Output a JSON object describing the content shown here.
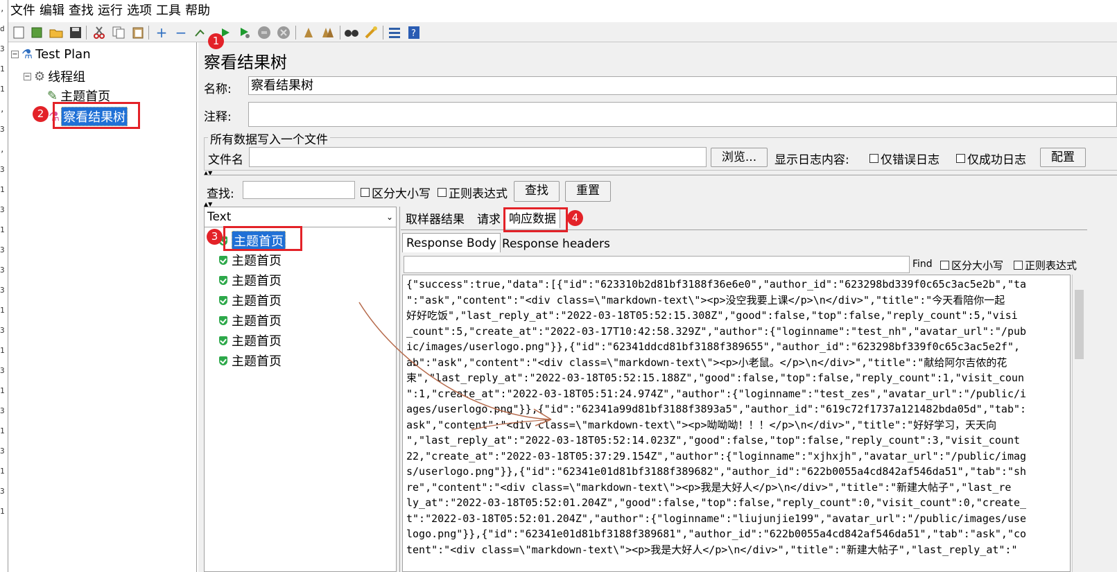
{
  "menu": [
    "文件",
    "编辑",
    "查找",
    "运行",
    "选项",
    "工具",
    "帮助"
  ],
  "tree": {
    "root": "Test Plan",
    "thread_group": "线程组",
    "sampler": "主题首页",
    "listener": "察看结果树"
  },
  "panel": {
    "title": "察看结果树",
    "name_label": "名称:",
    "name_value": "察看结果树",
    "comment_label": "注释:",
    "comment_value": "",
    "file_section": "所有数据写入一个文件",
    "filename_label": "文件名",
    "browse_button": "浏览...",
    "log_label": "显示日志内容:",
    "errors_only": "仅错误日志",
    "success_only": "仅成功日志",
    "config_button": "配置"
  },
  "search": {
    "label": "查找:",
    "case_sensitive": "区分大小写",
    "regex": "正则表达式",
    "find_button": "查找",
    "reset_button": "重置"
  },
  "results": {
    "renderer": "Text",
    "samples": [
      "主题首页",
      "主题首页",
      "主题首页",
      "主题首页",
      "主题首页",
      "主题首页",
      "主题首页"
    ]
  },
  "tabs": {
    "sampler_result": "取样器结果",
    "request": "请求",
    "response_data": "响应数据",
    "response_body": "Response Body",
    "response_headers": "Response headers"
  },
  "response_find": {
    "label": "Find",
    "case_sensitive": "区分大小写",
    "regex": "正则表达式"
  },
  "response_lines": [
    "{\"success\":true,\"data\":[{\"id\":\"623310b2d81bf3188f36e6e0\",\"author_id\":\"623298bd339f0c65c3ac5e2b\",\"ta",
    "\":\"ask\",\"content\":\"<div class=\\\"markdown-text\\\"><p>没空我要上课</p>\\n</div>\",\"title\":\"今天看陪你一起",
    "好好吃饭\",\"last_reply_at\":\"2022-03-18T05:52:15.308Z\",\"good\":false,\"top\":false,\"reply_count\":5,\"visi",
    "_count\":5,\"create_at\":\"2022-03-17T10:42:58.329Z\",\"author\":{\"loginname\":\"test_nh\",\"avatar_url\":\"/pub",
    "ic/images/userlogo.png\"}},{\"id\":\"62341ddcd81bf3188f389655\",\"author_id\":\"623298bf339f0c65c3ac5e2f\",",
    "ab\":\"ask\",\"content\":\"<div class=\\\"markdown-text\\\"><p>小老鼠。</p>\\n</div>\",\"title\":\"献给阿尔吉侬的花",
    "束\",\"last_reply_at\":\"2022-03-18T05:52:15.188Z\",\"good\":false,\"top\":false,\"reply_count\":1,\"visit_coun",
    "\":1,\"create_at\":\"2022-03-18T05:51:24.974Z\",\"author\":{\"loginname\":\"test_zes\",\"avatar_url\":\"/public/i",
    "ages/userlogo.png\"}},{\"id\":\"62341a99d81bf3188f3893a5\",\"author_id\":\"619c72f1737a121482bda05d\",\"tab\":",
    "ask\",\"content\":\"<div class=\\\"markdown-text\\\"><p>呦呦呦！！！</p>\\n</div>\",\"title\":\"好好学习，天天向",
    "\",\"last_reply_at\":\"2022-03-18T05:52:14.023Z\",\"good\":false,\"top\":false,\"reply_count\":3,\"visit_count",
    "22,\"create_at\":\"2022-03-18T05:37:29.154Z\",\"author\":{\"loginname\":\"xjhxjh\",\"avatar_url\":\"/public/imag",
    "s/userlogo.png\"}},{\"id\":\"62341e01d81bf3188f389682\",\"author_id\":\"622b0055a4cd842af546da51\",\"tab\":\"sh",
    "re\",\"content\":\"<div class=\\\"markdown-text\\\"><p>我是大好人</p>\\n</div>\",\"title\":\"新建大帖子\",\"last_re",
    "ly_at\":\"2022-03-18T05:52:01.204Z\",\"good\":false,\"top\":false,\"reply_count\":0,\"visit_count\":0,\"create_",
    "t\":\"2022-03-18T05:52:01.204Z\",\"author\":{\"loginname\":\"liujunjie199\",\"avatar_url\":\"/public/images/use",
    "logo.png\"}},{\"id\":\"62341e01d81bf3188f389681\",\"author_id\":\"622b0055a4cd842af546da51\",\"tab\":\"ask\",\"co",
    "tent\":\"<div class=\\\"markdown-text\\\"><p>我是大好人</p>\\n</div>\",\"title\":\"新建大帖子\",\"last_reply_at\":\""
  ],
  "badges": [
    "1",
    "2",
    "3",
    "4"
  ],
  "gutter": [
    ",",
    "d",
    "3",
    "1",
    "1",
    ",",
    "3",
    ",",
    "3",
    "1",
    "3",
    "1",
    "3",
    "3",
    "3",
    "1",
    "3",
    "1",
    "3",
    "1",
    "3",
    "1",
    "3",
    "1",
    "3",
    "1"
  ],
  "colors": {
    "highlight": "#e32228",
    "selection": "#1f70d6",
    "success": "#2da84a"
  }
}
